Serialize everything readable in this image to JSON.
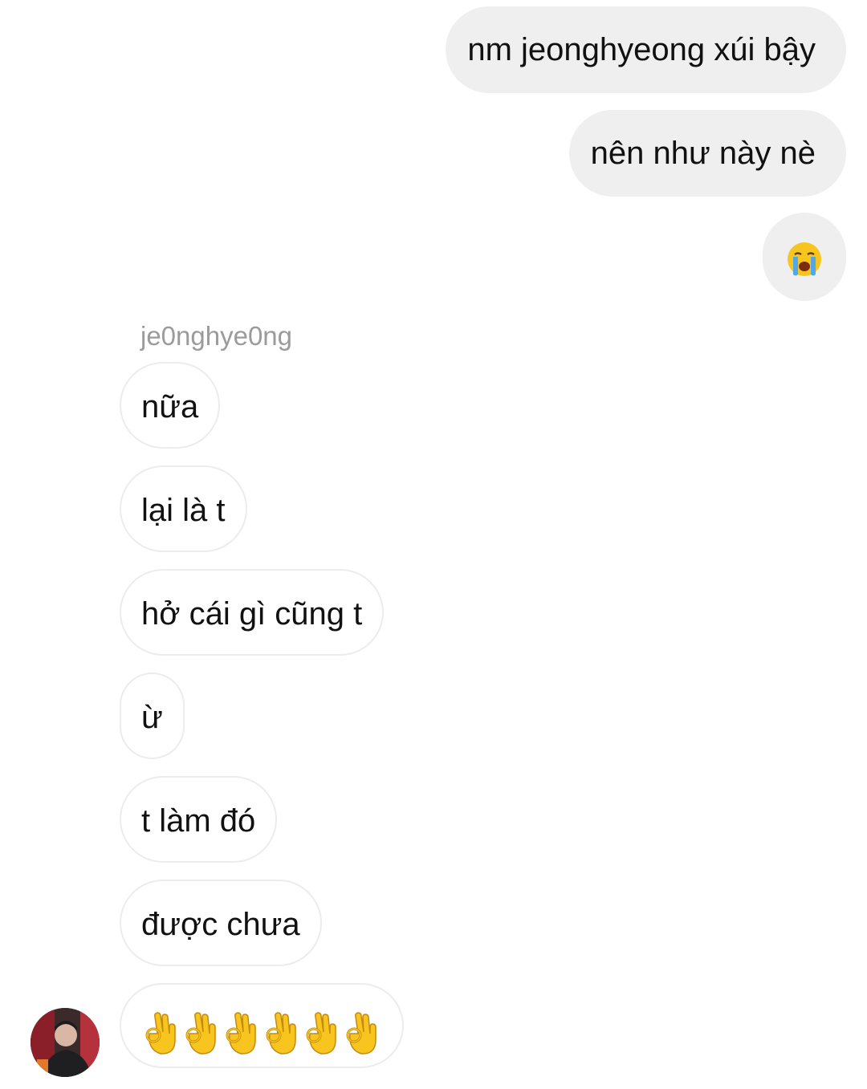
{
  "thread": {
    "sent_messages": [
      {
        "text": "nm jeonghyeong xúi bậy"
      },
      {
        "text": "nên như này nè"
      },
      {
        "emoji": "crying-face-emoji",
        "text": "😭"
      }
    ],
    "sender_name": "je0nghye0ng",
    "received_messages": [
      {
        "text": "nữa"
      },
      {
        "text": "lại là t"
      },
      {
        "text": "hở cái gì cũng t"
      },
      {
        "text": "ừ"
      },
      {
        "text": "t làm đó"
      },
      {
        "text": "được chưa"
      },
      {
        "emoji": "ok-hand-emoji",
        "count": 6,
        "text": "👌👌👌👌👌👌"
      }
    ],
    "avatar": {
      "icon": "profile-photo"
    }
  },
  "colors": {
    "sent_bubble": "#efefef",
    "received_bubble_border": "#ececec",
    "sender_name": "#9b9b9b",
    "emoji_yellow": "#f7c51e"
  }
}
